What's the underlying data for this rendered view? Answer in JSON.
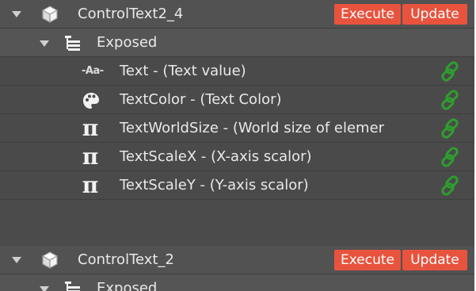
{
  "nodes": [
    {
      "name": "ControlText2_4",
      "execute_label": "Execute",
      "update_label": "Update",
      "group": {
        "label": "Exposed"
      },
      "properties": [
        {
          "label": "Text  - (Text value)",
          "icon": "text-field-icon",
          "icon_text": "-Aa-"
        },
        {
          "label": "TextColor  - (Text Color)",
          "icon": "palette-icon"
        },
        {
          "label": "TextWorldSize  - (World size of elemer",
          "icon": "pi-icon",
          "icon_text": "π"
        },
        {
          "label": "TextScaleX  - (X-axis scalor)",
          "icon": "pi-icon",
          "icon_text": "π"
        },
        {
          "label": "TextScaleY  - (Y-axis scalor)",
          "icon": "pi-icon",
          "icon_text": "π"
        }
      ]
    },
    {
      "name": "ControlText_2",
      "execute_label": "Execute",
      "update_label": "Update",
      "group": {
        "label": "Exposed"
      }
    }
  ],
  "colors": {
    "button_bg": "#e8533e",
    "link_green": "#2e9e2e",
    "panel_bg": "#4b4b4b"
  }
}
